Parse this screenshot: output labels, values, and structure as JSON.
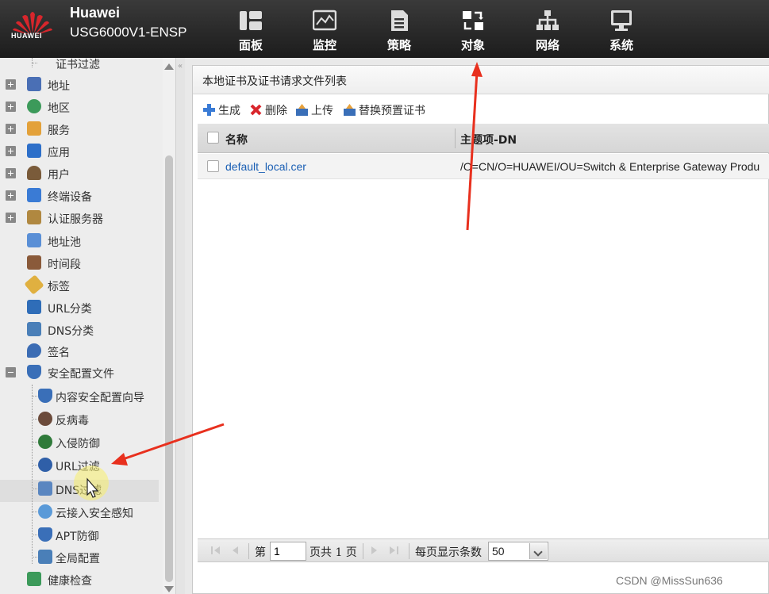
{
  "header": {
    "brand": "Huawei",
    "model": "USG6000V1-ENSP",
    "logo_text": "HUAWEI",
    "nav": [
      {
        "label": "面板",
        "icon": "dashboard-icon"
      },
      {
        "label": "监控",
        "icon": "monitor-icon"
      },
      {
        "label": "策略",
        "icon": "policy-icon"
      },
      {
        "label": "对象",
        "icon": "object-icon",
        "active": true
      },
      {
        "label": "网络",
        "icon": "network-icon"
      },
      {
        "label": "系统",
        "icon": "system-icon"
      }
    ]
  },
  "sidebar": {
    "items": [
      {
        "label": "证书过滤"
      },
      {
        "label": "地址",
        "expander": "plus"
      },
      {
        "label": "地区",
        "expander": "plus"
      },
      {
        "label": "服务",
        "expander": "plus"
      },
      {
        "label": "应用",
        "expander": "plus"
      },
      {
        "label": "用户",
        "expander": "plus"
      },
      {
        "label": "终端设备",
        "expander": "plus"
      },
      {
        "label": "认证服务器",
        "expander": "plus"
      },
      {
        "label": "地址池"
      },
      {
        "label": "时间段"
      },
      {
        "label": "标签"
      },
      {
        "label": "URL分类"
      },
      {
        "label": "DNS分类"
      },
      {
        "label": "签名"
      },
      {
        "label": "安全配置文件",
        "expander": "minus"
      },
      {
        "label": "内容安全配置向导"
      },
      {
        "label": "反病毒"
      },
      {
        "label": "入侵防御"
      },
      {
        "label": "URL过滤"
      },
      {
        "label": "DNS过滤",
        "selected": true
      },
      {
        "label": "云接入安全感知"
      },
      {
        "label": "APT防御"
      },
      {
        "label": "全局配置"
      },
      {
        "label": "健康检查"
      }
    ]
  },
  "main": {
    "title": "本地证书及证书请求文件列表",
    "toolbar": {
      "create": "生成",
      "delete": "删除",
      "upload": "上传",
      "replace": "替换预置证书"
    },
    "table": {
      "columns": [
        "名称",
        "主题项-DN"
      ],
      "rows": [
        {
          "name": "default_local.cer",
          "dn": "/O=CN/O=HUAWEI/OU=Switch & Enterprise Gateway Produ"
        }
      ]
    },
    "pager": {
      "page_prefix": "第",
      "page_value": "1",
      "total": "页共 1 页",
      "per_page_label": "每页显示条数",
      "per_page_value": "50"
    }
  },
  "watermark": "CSDN @MissSun636",
  "colors": {
    "header_bg": "#2a2a2a",
    "link": "#1a5fb4",
    "annotation_arrow": "#e8301e",
    "huawei_red": "#d7262c"
  }
}
